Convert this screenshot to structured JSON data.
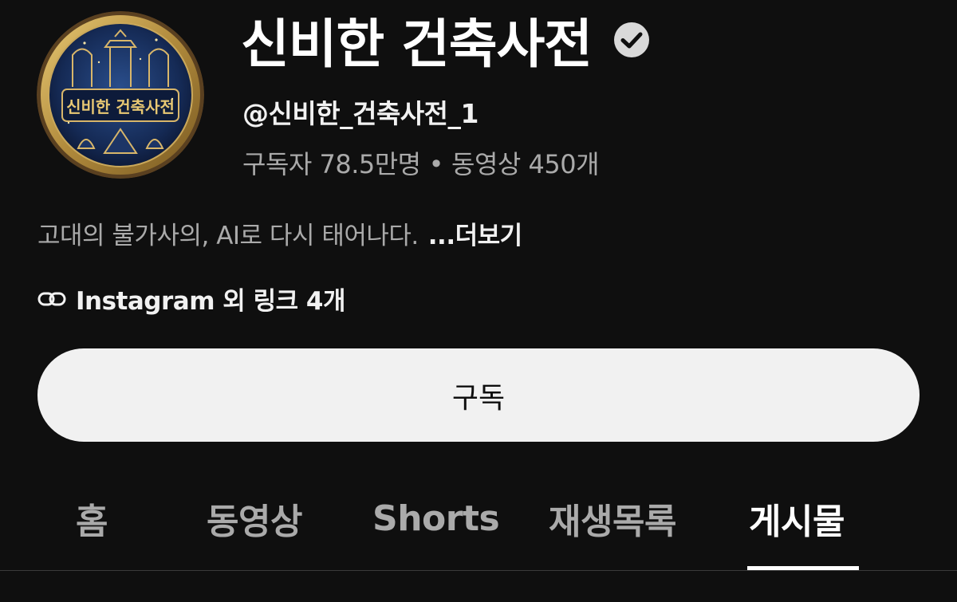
{
  "channel": {
    "name": "신비한 건축사전",
    "verified": true,
    "handle": "@신비한_건축사전_1",
    "avatar_text": "신비한 건축사전",
    "subscribers": "구독자 78.5만명",
    "separator": "•",
    "videos": "동영상 450개",
    "description": "고대의 불가사의, AI로 다시 태어나다.",
    "more_label": "...더보기",
    "links_label": "Instagram 외 링크 4개"
  },
  "subscribe": {
    "label": "구독"
  },
  "tabs": [
    {
      "label": "홈",
      "active": false
    },
    {
      "label": "동영상",
      "active": false
    },
    {
      "label": "Shorts",
      "active": false
    },
    {
      "label": "재생목록",
      "active": false
    },
    {
      "label": "게시물",
      "active": true
    }
  ],
  "colors": {
    "background": "#0f0f0f",
    "primary_text": "#f1f1f1",
    "secondary_text": "#aaaaaa",
    "button_bg": "#f1f1f1",
    "button_text": "#0f0f0f"
  },
  "icons": {
    "verified": "verified-check-icon",
    "link": "link-icon"
  }
}
